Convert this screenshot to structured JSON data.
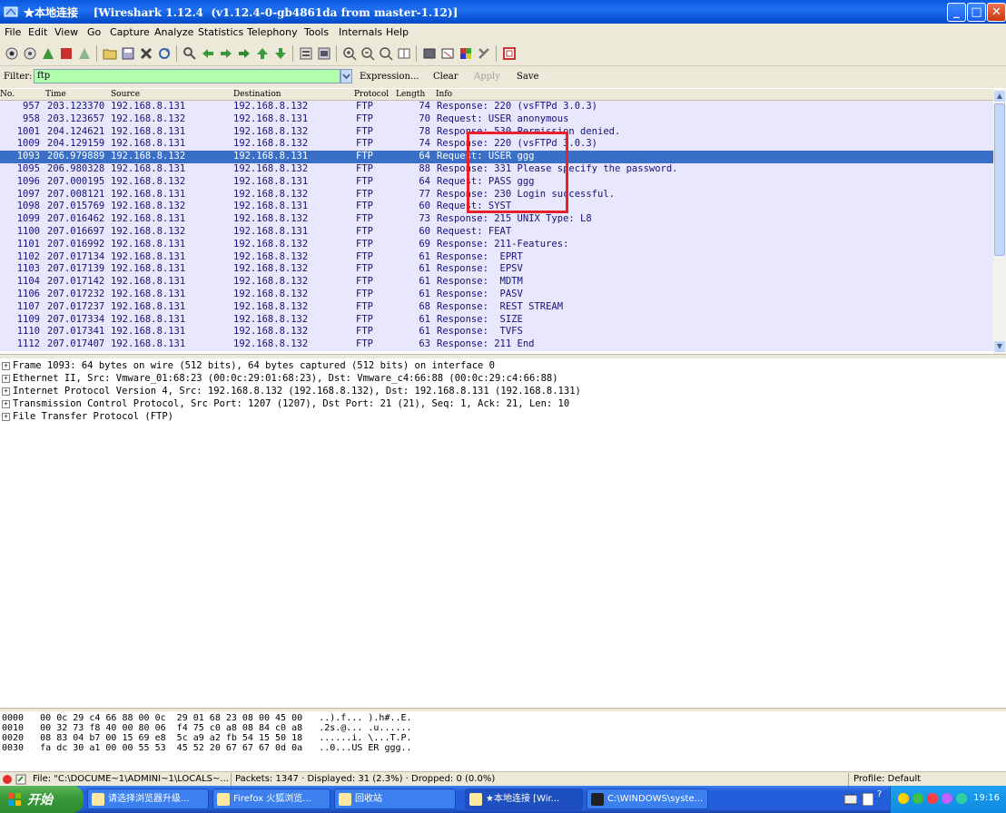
{
  "window": {
    "title": "★本地连接    [Wireshark 1.12.4  (v1.12.4-0-gb4861da from master-1.12)]",
    "min_label": "_",
    "max_label": "□",
    "close_label": "✕"
  },
  "menu": [
    "File",
    "Edit",
    "View",
    "Go",
    "Capture",
    "Analyze",
    "Statistics",
    "Telephony",
    "Tools",
    "Internals",
    "Help"
  ],
  "filter": {
    "label": "Filter:",
    "value": "ftp",
    "expression_label": "Expression...",
    "clear_label": "Clear",
    "apply_label": "Apply",
    "save_label": "Save"
  },
  "packet_list": {
    "columns": [
      "No.",
      "Time",
      "Source",
      "Destination",
      "Protocol",
      "Length",
      "Info"
    ],
    "rows": [
      {
        "no": "957",
        "time": "203.123370",
        "src": "192.168.8.131",
        "dst": "192.168.8.132",
        "proto": "FTP",
        "len": "74",
        "info": "Response: 220 (vsFTPd 3.0.3)"
      },
      {
        "no": "958",
        "time": "203.123657",
        "src": "192.168.8.132",
        "dst": "192.168.8.131",
        "proto": "FTP",
        "len": "70",
        "info": "Request: USER anonymous"
      },
      {
        "no": "1001",
        "time": "204.124621",
        "src": "192.168.8.131",
        "dst": "192.168.8.132",
        "proto": "FTP",
        "len": "78",
        "info": "Response: 530 Permission denied."
      },
      {
        "no": "1009",
        "time": "204.129159",
        "src": "192.168.8.131",
        "dst": "192.168.8.132",
        "proto": "FTP",
        "len": "74",
        "info": "Response: 220 (vsFTPd 3.0.3)"
      },
      {
        "no": "1093",
        "time": "206.979889",
        "src": "192.168.8.132",
        "dst": "192.168.8.131",
        "proto": "FTP",
        "len": "64",
        "info": "Request: USER ggg",
        "selected": true
      },
      {
        "no": "1095",
        "time": "206.980328",
        "src": "192.168.8.131",
        "dst": "192.168.8.132",
        "proto": "FTP",
        "len": "88",
        "info": "Response: 331 Please specify the password."
      },
      {
        "no": "1096",
        "time": "207.000195",
        "src": "192.168.8.132",
        "dst": "192.168.8.131",
        "proto": "FTP",
        "len": "64",
        "info": "Request: PASS ggg"
      },
      {
        "no": "1097",
        "time": "207.008121",
        "src": "192.168.8.131",
        "dst": "192.168.8.132",
        "proto": "FTP",
        "len": "77",
        "info": "Response: 230 Login successful."
      },
      {
        "no": "1098",
        "time": "207.015769",
        "src": "192.168.8.132",
        "dst": "192.168.8.131",
        "proto": "FTP",
        "len": "60",
        "info": "Request: SYST"
      },
      {
        "no": "1099",
        "time": "207.016462",
        "src": "192.168.8.131",
        "dst": "192.168.8.132",
        "proto": "FTP",
        "len": "73",
        "info": "Response: 215 UNIX Type: L8"
      },
      {
        "no": "1100",
        "time": "207.016697",
        "src": "192.168.8.132",
        "dst": "192.168.8.131",
        "proto": "FTP",
        "len": "60",
        "info": "Request: FEAT"
      },
      {
        "no": "1101",
        "time": "207.016992",
        "src": "192.168.8.131",
        "dst": "192.168.8.132",
        "proto": "FTP",
        "len": "69",
        "info": "Response: 211-Features:"
      },
      {
        "no": "1102",
        "time": "207.017134",
        "src": "192.168.8.131",
        "dst": "192.168.8.132",
        "proto": "FTP",
        "len": "61",
        "info": "Response:  EPRT"
      },
      {
        "no": "1103",
        "time": "207.017139",
        "src": "192.168.8.131",
        "dst": "192.168.8.132",
        "proto": "FTP",
        "len": "61",
        "info": "Response:  EPSV"
      },
      {
        "no": "1104",
        "time": "207.017142",
        "src": "192.168.8.131",
        "dst": "192.168.8.132",
        "proto": "FTP",
        "len": "61",
        "info": "Response:  MDTM"
      },
      {
        "no": "1106",
        "time": "207.017232",
        "src": "192.168.8.131",
        "dst": "192.168.8.132",
        "proto": "FTP",
        "len": "61",
        "info": "Response:  PASV"
      },
      {
        "no": "1107",
        "time": "207.017237",
        "src": "192.168.8.131",
        "dst": "192.168.8.132",
        "proto": "FTP",
        "len": "68",
        "info": "Response:  REST STREAM"
      },
      {
        "no": "1109",
        "time": "207.017334",
        "src": "192.168.8.131",
        "dst": "192.168.8.132",
        "proto": "FTP",
        "len": "61",
        "info": "Response:  SIZE"
      },
      {
        "no": "1110",
        "time": "207.017341",
        "src": "192.168.8.131",
        "dst": "192.168.8.132",
        "proto": "FTP",
        "len": "61",
        "info": "Response:  TVFS"
      },
      {
        "no": "1112",
        "time": "207.017407",
        "src": "192.168.8.131",
        "dst": "192.168.8.132",
        "proto": "FTP",
        "len": "63",
        "info": "Response: 211 End"
      }
    ]
  },
  "details": [
    "Frame 1093: 64 bytes on wire (512 bits), 64 bytes captured (512 bits) on interface 0",
    "Ethernet II, Src: Vmware_01:68:23 (00:0c:29:01:68:23), Dst: Vmware_c4:66:88 (00:0c:29:c4:66:88)",
    "Internet Protocol Version 4, Src: 192.168.8.132 (192.168.8.132), Dst: 192.168.8.131 (192.168.8.131)",
    "Transmission Control Protocol, Src Port: 1207 (1207), Dst Port: 21 (21), Seq: 1, Ack: 21, Len: 10",
    "File Transfer Protocol (FTP)"
  ],
  "bytes": [
    {
      "off": "0000",
      "hex": "00 0c 29 c4 66 88 00 0c  29 01 68 23 08 00 45 00",
      "ascii": "..).f... ).h#..E."
    },
    {
      "off": "0010",
      "hex": "00 32 73 f8 40 00 80 06  f4 75 c0 a8 08 84 c0 a8",
      "ascii": ".2s.@... .u......"
    },
    {
      "off": "0020",
      "hex": "08 83 04 b7 00 15 69 e8  5c a9 a2 fb 54 15 50 18",
      "ascii": "......i. \\...T.P."
    },
    {
      "off": "0030",
      "hex": "fa dc 30 a1 00 00 55 53  45 52 20 67 67 67 0d 0a",
      "ascii": "..0...US ER ggg.."
    }
  ],
  "status": {
    "file": "File: \"C:\\DOCUME~1\\ADMINI~1\\LOCALS~...",
    "packets": "Packets: 1347 · Displayed: 31 (2.3%) · Dropped: 0 (0.0%)",
    "profile": "Profile: Default"
  },
  "taskbar": {
    "start_label": "开始",
    "tasks": [
      "请选择浏览器升级...",
      "Firefox 火狐浏览...",
      "回收站",
      "★本地连接  [Wir...",
      "C:\\WINDOWS\\syste..."
    ],
    "clock": "19:16"
  },
  "colors": {
    "filter_ok": "#afffaf",
    "selected_row": "#3a6fc8",
    "row_bg": "#e8e7fe",
    "annotation": "#e8202a"
  }
}
